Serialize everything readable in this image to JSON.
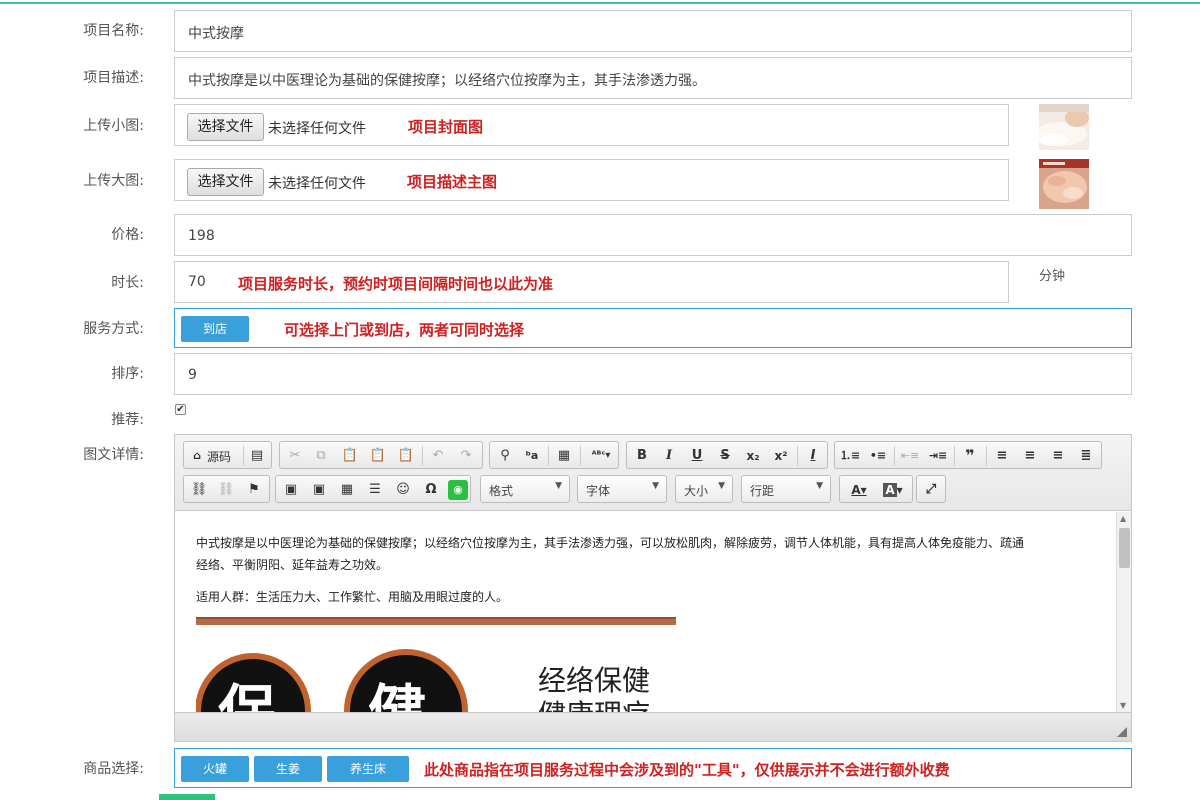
{
  "form": {
    "name": {
      "label": "项目名称:",
      "value": "中式按摩"
    },
    "desc": {
      "label": "项目描述:",
      "value": "中式按摩是以中医理论为基础的保健按摩；以经络穴位按摩为主，其手法渗透力强。"
    },
    "small_img": {
      "label": "上传小图:",
      "button": "选择文件",
      "status": "未选择任何文件",
      "note": "项目封面图"
    },
    "large_img": {
      "label": "上传大图:",
      "button": "选择文件",
      "status": "未选择任何文件",
      "note": "项目描述主图"
    },
    "price": {
      "label": "价格:",
      "value": "198"
    },
    "duration": {
      "label": "时长:",
      "value": "70",
      "note": "项目服务时长，预约时项目间隔时间也以此为准",
      "unit": "分钟"
    },
    "service": {
      "label": "服务方式:",
      "option": "到店",
      "note": "可选择上门或到店，两者可同时选择"
    },
    "sort": {
      "label": "排序:",
      "value": "9"
    },
    "recommend": {
      "label": "推荐:",
      "checked": true
    },
    "detail": {
      "label": "图文详情:"
    },
    "goods": {
      "label": "商品选择:",
      "items": [
        "火罐",
        "生姜",
        "养生床"
      ],
      "note": "此处商品指在项目服务过程中会涉及到的\"工具\"，仅供展示并不会进行额外收费"
    }
  },
  "editor": {
    "source_label": "源码",
    "format_label": "格式",
    "font_label": "字体",
    "size_label": "大小",
    "lineheight_label": "行距",
    "paragraph1": "中式按摩是以中医理论为基础的保健按摩；以经络穴位按摩为主，其手法渗透力强，可以放松肌肉，解除疲劳，调节人体机能，具有提高人体免疫能力、疏通",
    "paragraph1b": "经络、平衡阴阳、延年益寿之功效。",
    "paragraph2": "适用人群：生活压力大、工作繁忙、用脑及用眼过度的人。",
    "image_text1": "经络保健",
    "image_text2": "健康理疗",
    "image_big1": "保",
    "image_big2": "健"
  },
  "colors": {
    "accent": "#3aa0dc",
    "note": "#d02020",
    "top_line": "#3cbdb3"
  }
}
